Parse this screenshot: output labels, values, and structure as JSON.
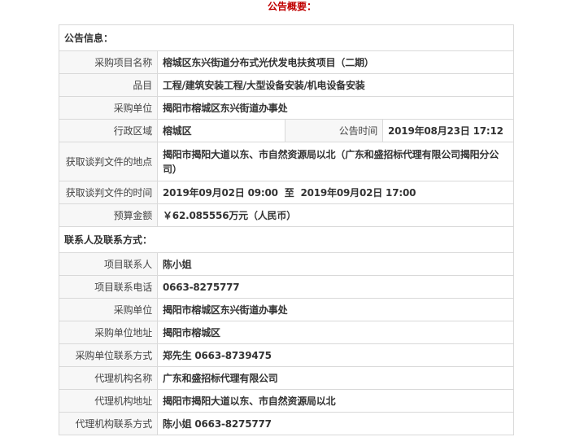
{
  "header": {
    "title": "公告概要："
  },
  "notice_info": {
    "section_title": "公告信息：",
    "project_name_label": "采购项目名称",
    "project_name": "榕城区东兴街道分布式光伏发电扶贫项目（二期）",
    "category_label": "品目",
    "category": "工程/建筑安装工程/大型设备安装/机电设备安装",
    "purchaser_label": "采购单位",
    "purchaser": "揭阳市榕城区东兴街道办事处",
    "region_label": "行政区域",
    "region": "榕城区",
    "publish_time_label": "公告时间",
    "publish_time": "2019年08月23日 17:12",
    "doc_location_label": "获取谈判文件的地点",
    "doc_location": "揭阳市揭阳大道以东、市自然资源局以北（广东和盛招标代理有限公司揭阳分公司）",
    "doc_time_label": "获取谈判文件的时间",
    "doc_time": "2019年09月02日 09:00  至  2019年09月02日 17:00",
    "budget_label": "预算金额",
    "budget": "￥62.085556万元（人民币）"
  },
  "contacts": {
    "section_title": "联系人及联系方式：",
    "project_contact_label": "项目联系人",
    "project_contact": "陈小姐",
    "project_phone_label": "项目联系电话",
    "project_phone": "0663-8275777",
    "purchaser_label": "采购单位",
    "purchaser": "揭阳市榕城区东兴街道办事处",
    "purchaser_address_label": "采购单位地址",
    "purchaser_address": "揭阳市榕城区",
    "purchaser_contact_label": "采购单位联系方式",
    "purchaser_contact": "郑先生 0663-8739475",
    "agency_name_label": "代理机构名称",
    "agency_name": "广东和盛招标代理有限公司",
    "agency_address_label": "代理机构地址",
    "agency_address": "揭阳市揭阳大道以东、市自然资源局以北",
    "agency_contact_label": "代理机构联系方式",
    "agency_contact": "陈小姐 0663-8275777"
  }
}
